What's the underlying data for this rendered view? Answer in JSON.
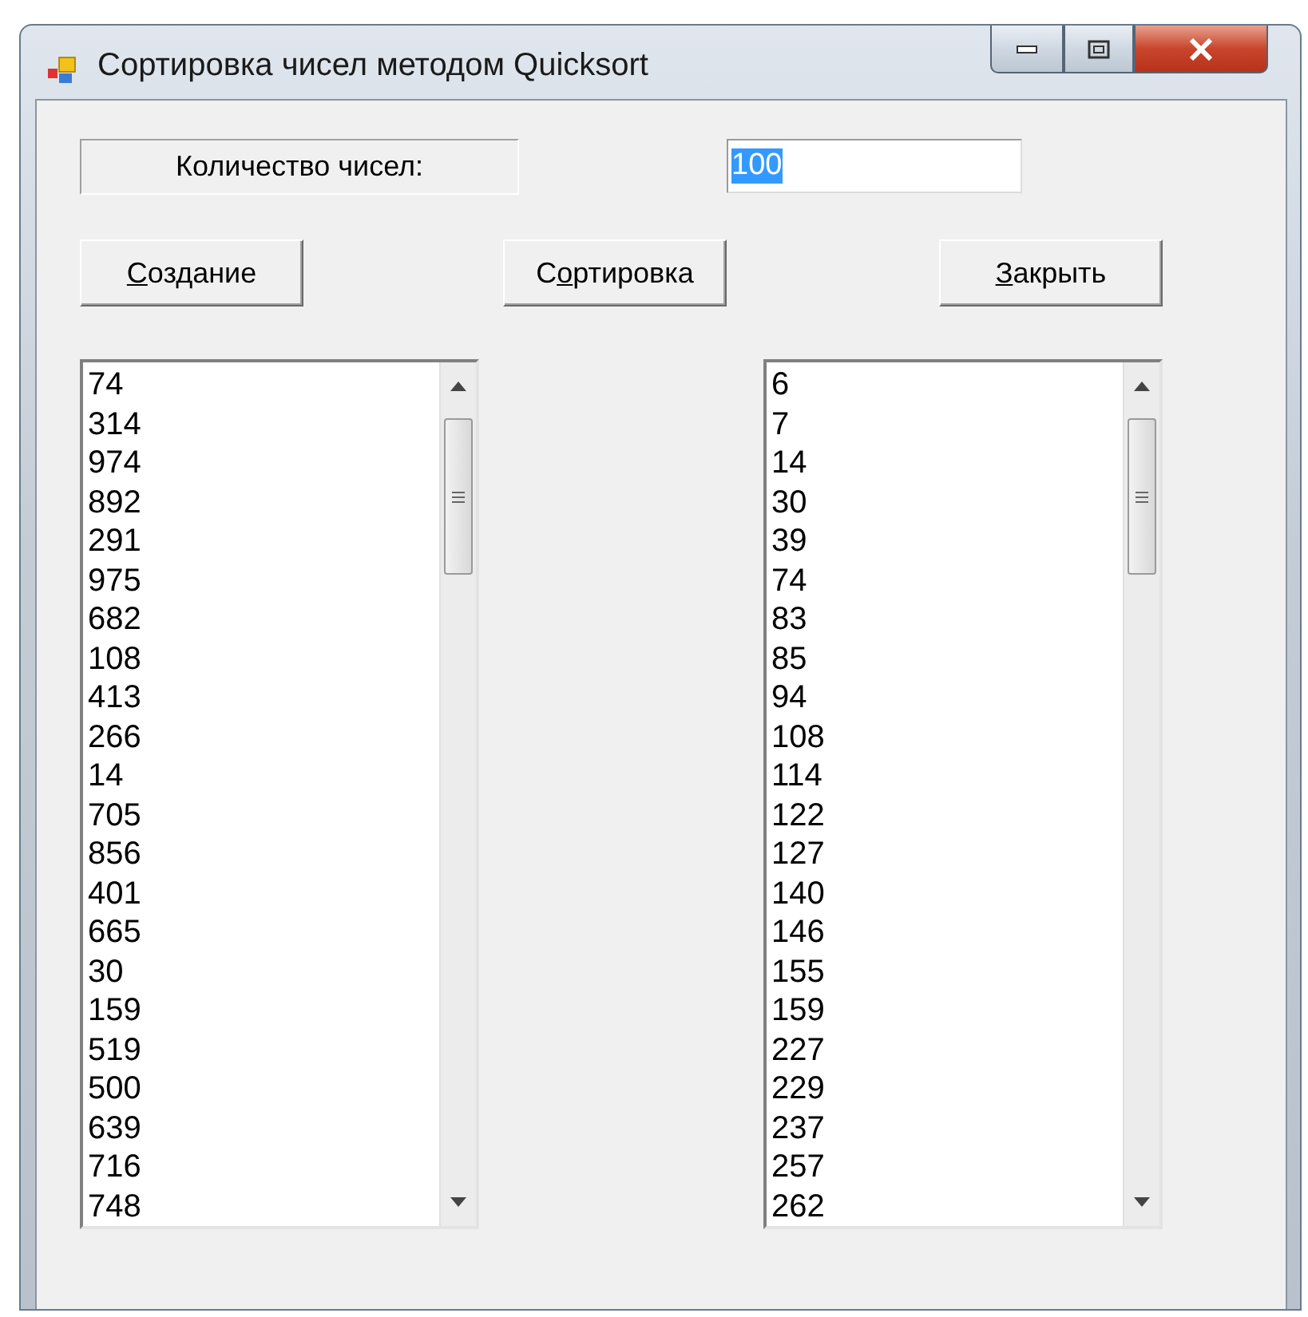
{
  "window": {
    "title": "Сортировка чисел методом Quicksort"
  },
  "count_label": "Количество чисел:",
  "count_field": {
    "value": "100",
    "selected": true
  },
  "buttons": [
    {
      "access_key": "С",
      "after": "оздание"
    },
    {
      "before": "С",
      "access_key": "о",
      "after": "ртировка"
    },
    {
      "access_key": "З",
      "after": "акрыть"
    }
  ],
  "lists": [
    {
      "items": [
        "74",
        "314",
        "974",
        "892",
        "291",
        "975",
        "682",
        "108",
        "413",
        "266",
        "14",
        "705",
        "856",
        "401",
        "665",
        "30",
        "159",
        "519",
        "500",
        "639",
        "716",
        "748"
      ]
    },
    {
      "items": [
        "6",
        "7",
        "14",
        "30",
        "39",
        "74",
        "83",
        "85",
        "94",
        "108",
        "114",
        "122",
        "127",
        "140",
        "146",
        "155",
        "159",
        "227",
        "229",
        "237",
        "257",
        "262"
      ]
    }
  ]
}
